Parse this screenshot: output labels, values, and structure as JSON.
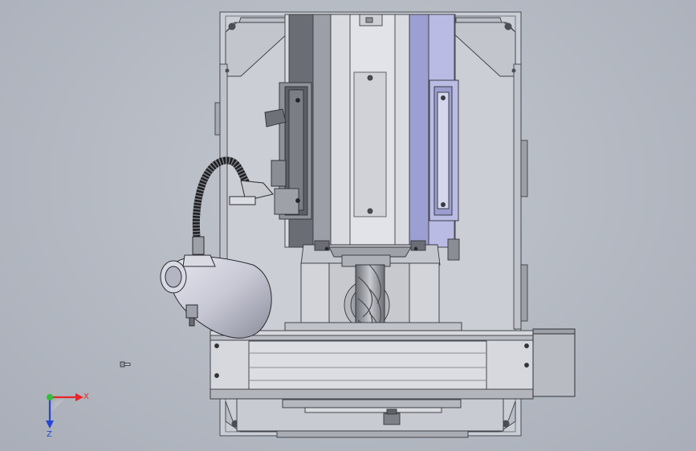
{
  "viewport": {
    "background_top": "#c3c8d0",
    "background_bottom": "#a9aeb8"
  },
  "colors": {
    "frame": "#c9ccd4",
    "frame_dark": "#7d8088",
    "column_blue": "#b7b9e0",
    "rail_dark": "#5c5f66",
    "casting": "#d4d6dc",
    "tool": "#8e9097",
    "lamp": "#c6c7d3",
    "hose": "#2b2b2b",
    "axis_x": "#e8252a",
    "axis_y": "#2fbf3a",
    "axis_z": "#2446d8"
  },
  "icons": {
    "triad": "coordinate-triad-icon",
    "screw": "screw-icon"
  },
  "triad": {
    "x_label": "X",
    "y_label": "",
    "z_label": "Z"
  }
}
